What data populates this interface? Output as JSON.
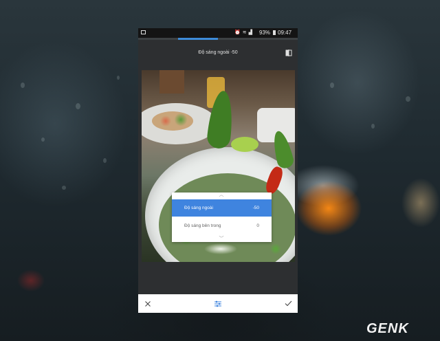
{
  "status_bar": {
    "battery": "93%",
    "time": "09:47"
  },
  "tool_progress": 0.25,
  "header": {
    "title": "Độ sáng ngoài -50"
  },
  "adjust_menu": {
    "items": [
      {
        "label": "Độ sáng ngoài",
        "value": "-50",
        "selected": true
      },
      {
        "label": "Độ sáng bên trong",
        "value": "0",
        "selected": false
      }
    ]
  },
  "bottom_bar": {
    "icons": [
      "close-icon",
      "tune-sliders-icon",
      "checkmark-icon"
    ]
  },
  "watermark": {
    "text": "GENK"
  },
  "colors": {
    "accent": "#3f84df",
    "progress": "#3d8bd8",
    "toolbar_bg": "#2d2f31"
  }
}
